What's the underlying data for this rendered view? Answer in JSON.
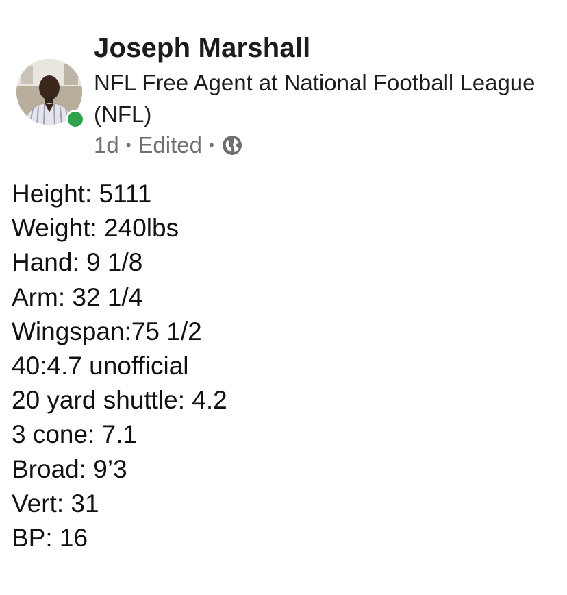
{
  "post": {
    "author": {
      "name": "Joseph Marshall",
      "headline": "NFL Free Agent at National Football League (NFL)",
      "online": true
    },
    "meta": {
      "age": "1d",
      "separator": "•",
      "edited": "Edited",
      "visibility_icon": "globe-icon"
    },
    "body_lines": [
      "Height: 5111",
      "Weight: 240lbs",
      "Hand: 9 1/8",
      "Arm: 32 1/4",
      "Wingspan:75 1/2",
      "40:4.7 unofficial",
      "20 yard shuttle: 4.2",
      "3 cone: 7.1",
      "Broad: 9’3",
      "Vert: 31",
      "BP: 16"
    ]
  },
  "colors": {
    "text": "#1c1c1e",
    "meta_text": "#6e6e73",
    "online_indicator": "#31a24c",
    "background": "#ffffff"
  }
}
